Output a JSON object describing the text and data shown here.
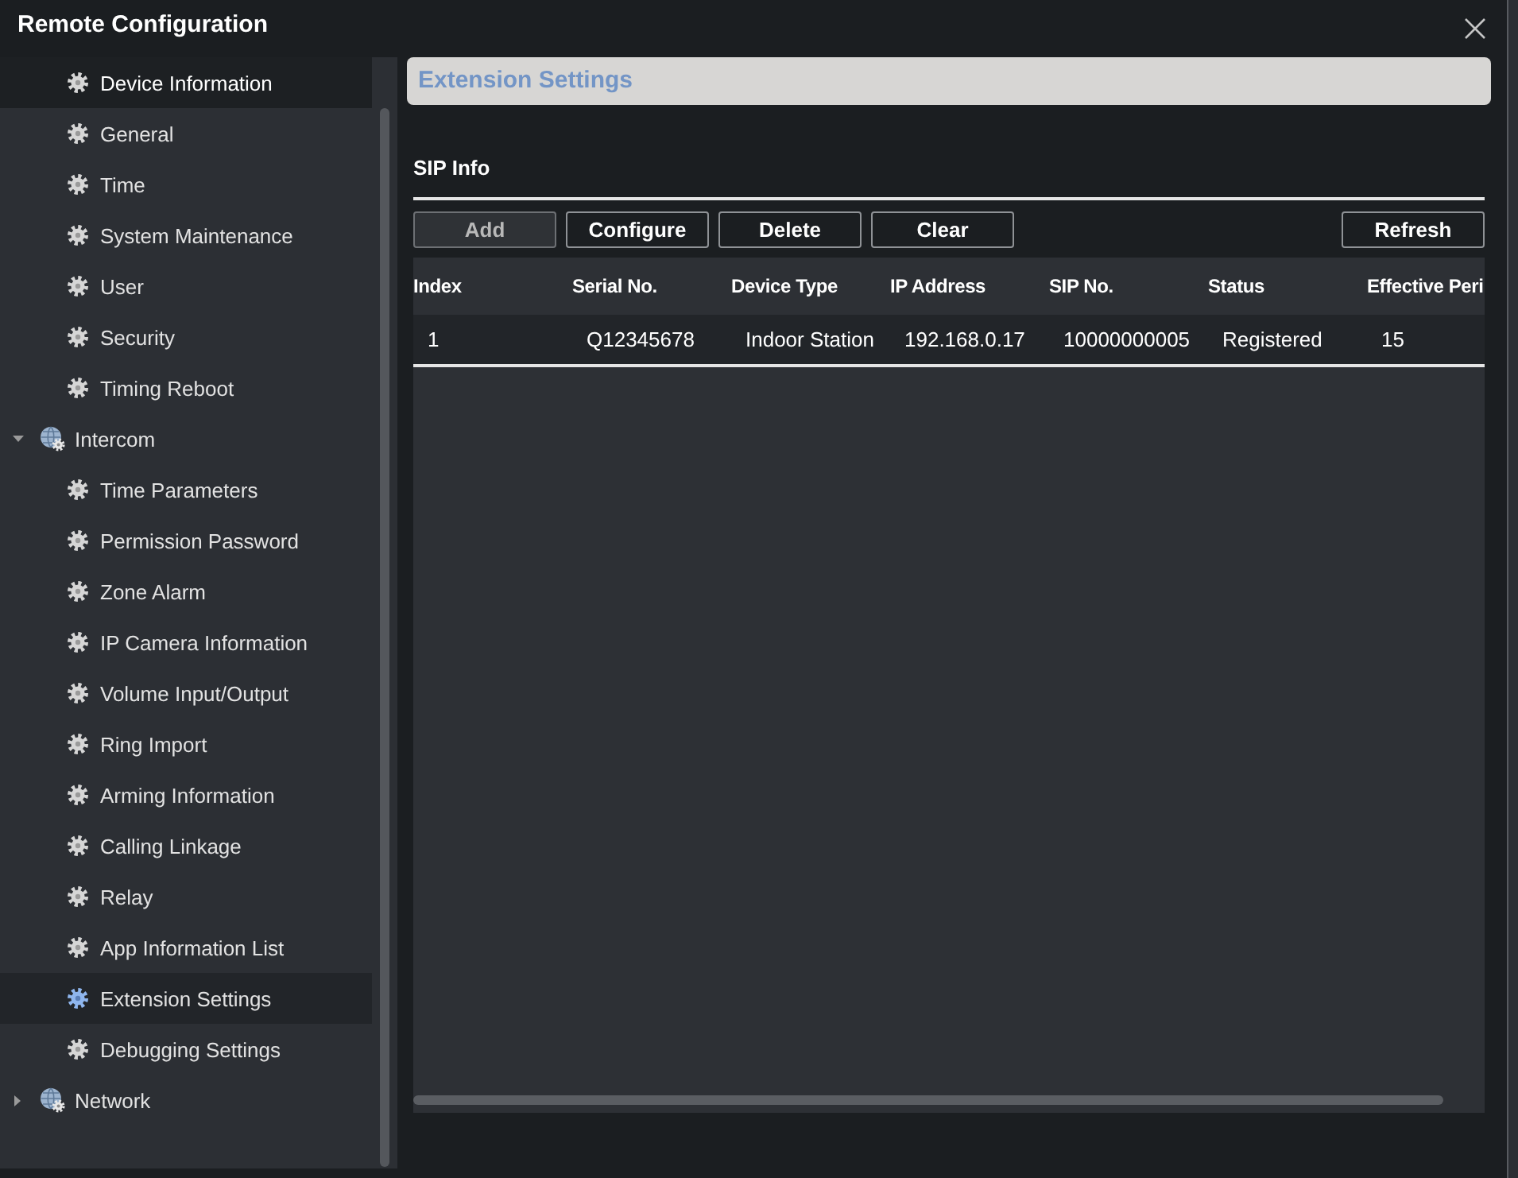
{
  "window": {
    "title": "Remote Configuration"
  },
  "sidebar": {
    "items": [
      {
        "kind": "leaf",
        "label": "Device Information",
        "selected": false,
        "hovered": true
      },
      {
        "kind": "leaf",
        "label": "General",
        "selected": false,
        "hovered": false
      },
      {
        "kind": "leaf",
        "label": "Time",
        "selected": false,
        "hovered": false
      },
      {
        "kind": "leaf",
        "label": "System Maintenance",
        "selected": false,
        "hovered": false
      },
      {
        "kind": "leaf",
        "label": "User",
        "selected": false,
        "hovered": false
      },
      {
        "kind": "leaf",
        "label": "Security",
        "selected": false,
        "hovered": false
      },
      {
        "kind": "leaf",
        "label": "Timing Reboot",
        "selected": false,
        "hovered": false
      },
      {
        "kind": "group",
        "label": "Intercom",
        "expanded": true,
        "selected": false,
        "hovered": false,
        "children": [
          {
            "kind": "leaf",
            "label": "Time Parameters",
            "selected": false,
            "hovered": false
          },
          {
            "kind": "leaf",
            "label": "Permission Password",
            "selected": false,
            "hovered": false
          },
          {
            "kind": "leaf",
            "label": "Zone Alarm",
            "selected": false,
            "hovered": false
          },
          {
            "kind": "leaf",
            "label": "IP Camera Information",
            "selected": false,
            "hovered": false
          },
          {
            "kind": "leaf",
            "label": "Volume Input/Output",
            "selected": false,
            "hovered": false
          },
          {
            "kind": "leaf",
            "label": "Ring Import",
            "selected": false,
            "hovered": false
          },
          {
            "kind": "leaf",
            "label": "Arming Information",
            "selected": false,
            "hovered": false
          },
          {
            "kind": "leaf",
            "label": "Calling Linkage",
            "selected": false,
            "hovered": false
          },
          {
            "kind": "leaf",
            "label": "Relay",
            "selected": false,
            "hovered": false
          },
          {
            "kind": "leaf",
            "label": "App Information List",
            "selected": false,
            "hovered": false
          },
          {
            "kind": "leaf",
            "label": "Extension Settings",
            "selected": true,
            "hovered": false
          },
          {
            "kind": "leaf",
            "label": "Debugging Settings",
            "selected": false,
            "hovered": false
          }
        ]
      },
      {
        "kind": "group",
        "label": "Network",
        "expanded": false,
        "selected": false,
        "hovered": false
      }
    ]
  },
  "panel": {
    "title": "Extension Settings"
  },
  "section": {
    "title": "SIP Info"
  },
  "toolbar": {
    "buttons": [
      {
        "label": "Add",
        "disabled": true
      },
      {
        "label": "Configure",
        "disabled": false
      },
      {
        "label": "Delete",
        "disabled": false
      },
      {
        "label": "Clear",
        "disabled": false
      }
    ],
    "end_buttons": [
      {
        "label": "Refresh",
        "disabled": false
      }
    ]
  },
  "table": {
    "columns": [
      "Index",
      "Serial No.",
      "Device Type",
      "IP Address",
      "SIP No.",
      "Status",
      "Effective Peri"
    ],
    "rows": [
      [
        "1",
        "Q12345678",
        "Indoor Station",
        "192.168.0.17",
        "10000000005",
        "Registered",
        "15"
      ]
    ]
  }
}
